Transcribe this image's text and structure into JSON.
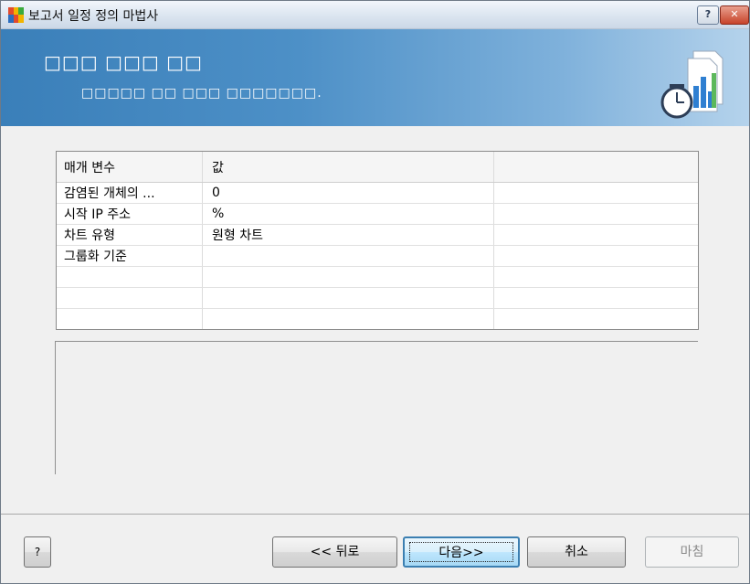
{
  "window": {
    "title": "보고서 일정 정의 마법사",
    "help_label": "?",
    "close_label": "✕"
  },
  "banner": {
    "title": "□□□ □□□ □□",
    "subtitle": "□□□□□ □□ □□□ □□□□□□□."
  },
  "grid": {
    "columns": [
      "매개 변수",
      "값",
      ""
    ],
    "rows": [
      {
        "param": "감염된 개체의 ...",
        "value": "0"
      },
      {
        "param": "시작 IP 주소",
        "value": "%"
      },
      {
        "param": "차트 유형",
        "value": "원형 차트"
      },
      {
        "param": "그룹화 기준",
        "value": ""
      }
    ]
  },
  "buttons": {
    "help": "?",
    "back": "<< 뒤로",
    "next": "다음>>",
    "cancel": "취소",
    "finish": "마침"
  }
}
